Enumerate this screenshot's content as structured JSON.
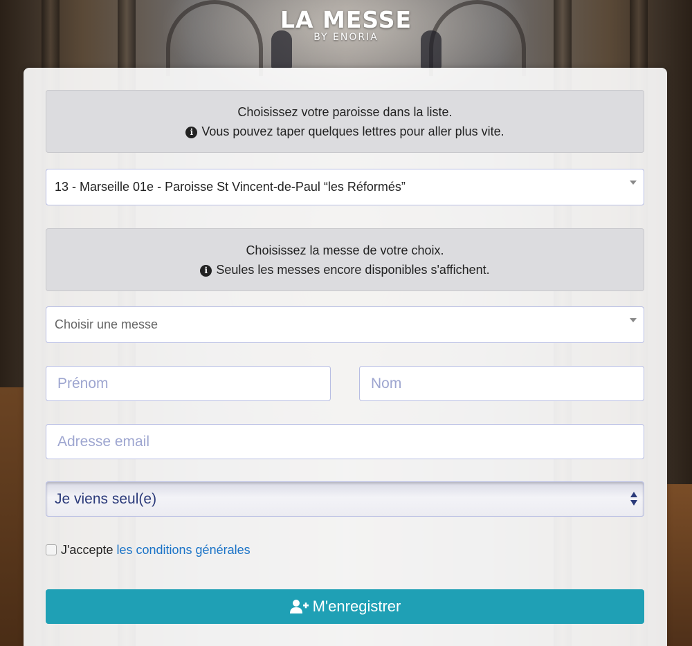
{
  "brand": {
    "title": "LA MESSE",
    "subtitle": "BY ENORIA",
    "color": "#ffffff"
  },
  "form": {
    "parish_info": {
      "line1": "Choisissez votre paroisse dans la liste.",
      "line2": "Vous pouvez taper quelques lettres pour aller plus vite."
    },
    "parish_select": {
      "selected": "13 - Marseille 01e - Paroisse St Vincent-de-Paul “les Réformés”"
    },
    "mass_info": {
      "line1": "Choisissez la messe de votre choix.",
      "line2": "Seules les messes encore disponibles s'affichent."
    },
    "mass_select": {
      "placeholder": "Choisir une messe"
    },
    "first_name": {
      "placeholder": "Prénom",
      "value": ""
    },
    "last_name": {
      "placeholder": "Nom",
      "value": ""
    },
    "email": {
      "placeholder": "Adresse email",
      "value": ""
    },
    "attendance_select": {
      "selected": "Je viens seul(e)"
    },
    "terms": {
      "prefix": "J'accepte",
      "link": "les conditions générales",
      "checked": false
    },
    "submit": {
      "label": "M'enregistrer",
      "icon": "user-plus-icon",
      "color": "#1fa0b5"
    }
  },
  "colors": {
    "link": "#1a73c7",
    "input_border": "#b7bde3",
    "placeholder": "#9ea6d0",
    "info_bg": "#dcdcdf"
  }
}
